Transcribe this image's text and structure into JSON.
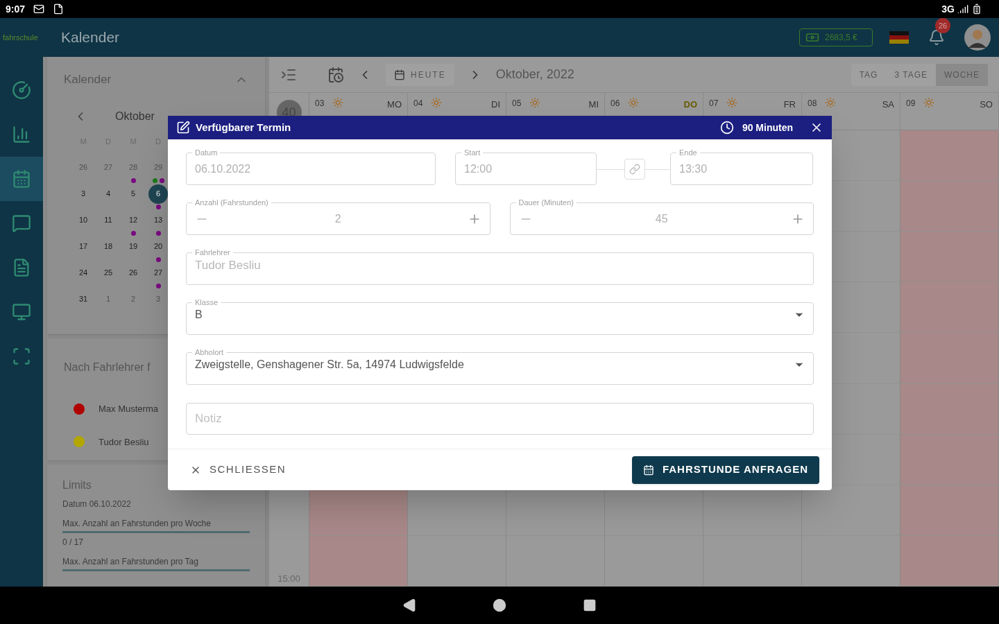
{
  "status_bar": {
    "time": "9:07",
    "network": "3G"
  },
  "app_bar": {
    "logo": "fahrschule",
    "title": "Kalender",
    "balance": "2683,5 €",
    "notifications": "26"
  },
  "sidebar": {
    "items": [
      {
        "kind": "gauge",
        "selected": false
      },
      {
        "kind": "chart",
        "selected": false
      },
      {
        "kind": "calendar",
        "selected": true
      },
      {
        "kind": "chat",
        "selected": false
      },
      {
        "kind": "document",
        "selected": false
      },
      {
        "kind": "monitor",
        "selected": false
      },
      {
        "kind": "scan",
        "selected": false
      }
    ]
  },
  "mini_calendar": {
    "title": "Kalender",
    "month": "Oktober",
    "weekdays": [
      "M",
      "D",
      "M",
      "D"
    ],
    "weeks": [
      [
        {
          "day": "26",
          "muted": true,
          "selected": false
        },
        {
          "day": "27",
          "muted": true,
          "selected": false
        },
        {
          "day": "28",
          "muted": true,
          "selected": false,
          "dots": [
            {
              "color": "#7a0a80"
            }
          ]
        },
        {
          "day": "29",
          "muted": true,
          "selected": false,
          "dots": [
            {
              "color": "#1d7a1d"
            },
            {
              "color": "#7a0a80"
            }
          ]
        }
      ],
      [
        {
          "day": "3",
          "muted": false,
          "selected": false
        },
        {
          "day": "4",
          "muted": false,
          "selected": false
        },
        {
          "day": "5",
          "muted": false,
          "selected": false
        },
        {
          "day": "6",
          "muted": false,
          "selected": true,
          "dots": [
            {
              "color": "#7a0a80"
            }
          ]
        }
      ],
      [
        {
          "day": "10",
          "muted": false,
          "selected": false
        },
        {
          "day": "11",
          "muted": false,
          "selected": false
        },
        {
          "day": "12",
          "muted": false,
          "selected": false,
          "dots": [
            {
              "color": "#7a0a80"
            }
          ]
        },
        {
          "day": "13",
          "muted": false,
          "selected": false,
          "dots": [
            {
              "color": "#7a0a80"
            }
          ]
        }
      ],
      [
        {
          "day": "17",
          "muted": false,
          "selected": false
        },
        {
          "day": "18",
          "muted": false,
          "selected": false
        },
        {
          "day": "19",
          "muted": false,
          "selected": false
        },
        {
          "day": "20",
          "muted": false,
          "selected": false,
          "dots": [
            {
              "color": "#7a0a80"
            }
          ]
        }
      ],
      [
        {
          "day": "24",
          "muted": false,
          "selected": false
        },
        {
          "day": "25",
          "muted": false,
          "selected": false
        },
        {
          "day": "26",
          "muted": false,
          "selected": false
        },
        {
          "day": "27",
          "muted": false,
          "selected": false,
          "dots": [
            {
              "color": "#7a0a80"
            }
          ]
        }
      ],
      [
        {
          "day": "31",
          "muted": false,
          "selected": false
        },
        {
          "day": "1",
          "muted": true,
          "selected": false
        },
        {
          "day": "2",
          "muted": true,
          "selected": false
        },
        {
          "day": "3",
          "muted": true,
          "selected": false
        }
      ]
    ]
  },
  "teacher_filter": {
    "title": "Nach Fahrlehrer f",
    "teachers": [
      {
        "name": "Max Musterma",
        "color": "#b00000"
      },
      {
        "name": "Tudor Besliu",
        "color": "#b3a600"
      }
    ]
  },
  "limits": {
    "title": "Limits",
    "date": "Datum 06.10.2022",
    "items": [
      {
        "label": "Max. Anzahl an Fahrstunden pro Woche",
        "level": 0,
        "reading": "0 / 17"
      },
      {
        "label": "Max. Anzahl an Fahrstunden pro Tag",
        "level": 0
      }
    ]
  },
  "toolbar": {
    "today": "HEUTE",
    "month": "Oktober, 2022",
    "views": [
      {
        "label": "TAG",
        "selected": false
      },
      {
        "label": "3 TAGE",
        "selected": false
      },
      {
        "label": "WOCHE",
        "selected": true
      }
    ]
  },
  "week": {
    "number": "40",
    "days": [
      {
        "day": "03",
        "weekday": "MO",
        "past": true,
        "today": false
      },
      {
        "day": "04",
        "weekday": "DI",
        "past": false,
        "today": false
      },
      {
        "day": "05",
        "weekday": "MI",
        "past": false,
        "today": false
      },
      {
        "day": "06",
        "weekday": "DO",
        "past": false,
        "today": true
      },
      {
        "day": "07",
        "weekday": "FR",
        "past": false,
        "today": false
      },
      {
        "day": "08",
        "weekday": "SA",
        "past": false,
        "today": false
      },
      {
        "day": "09",
        "weekday": "SO",
        "past": true,
        "today": false
      }
    ],
    "hour": "15:00"
  },
  "dialog": {
    "title": "Verfügbarer Termin",
    "duration": "90 Minuten",
    "date": {
      "label": "Datum",
      "value": "06.10.2022"
    },
    "start": {
      "label": "Start",
      "value": "12:00"
    },
    "end": {
      "label": "Ende",
      "value": "13:30"
    },
    "count": {
      "label": "Anzahl (Fahrstunden)",
      "value": "2"
    },
    "length": {
      "label": "Dauer (Minuten)",
      "value": "45"
    },
    "teacher": {
      "label": "Fahrlehrer",
      "value": "Tudor Besliu"
    },
    "class": {
      "label": "Klasse",
      "value": "B"
    },
    "pickup": {
      "label": "Abholort",
      "value": "Zweigstelle, Genshagener Str. 5a, 14974 Ludwigsfelde"
    },
    "note": {
      "placeholder": "Notiz"
    },
    "close": "SCHLIESSEN",
    "submit": "FAHRSTUNDE ANFRAGEN"
  }
}
